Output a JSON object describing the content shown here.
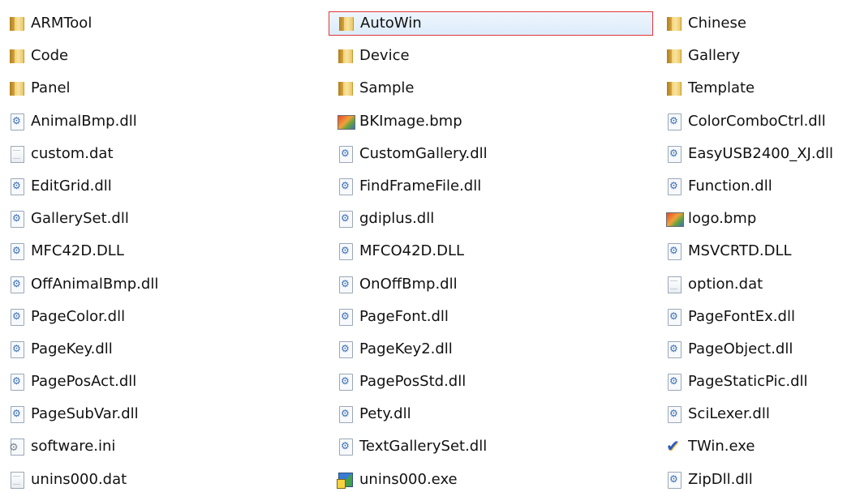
{
  "files": [
    {
      "name": "ARMTool",
      "icon": "folder-icon",
      "selected": false
    },
    {
      "name": "Code",
      "icon": "folder-icon",
      "selected": false
    },
    {
      "name": "Panel",
      "icon": "folder-icon",
      "selected": false
    },
    {
      "name": "AnimalBmp.dll",
      "icon": "dll-icon",
      "selected": false
    },
    {
      "name": "custom.dat",
      "icon": "dat-file-icon",
      "selected": false
    },
    {
      "name": "EditGrid.dll",
      "icon": "dll-icon",
      "selected": false
    },
    {
      "name": "GallerySet.dll",
      "icon": "dll-icon",
      "selected": false
    },
    {
      "name": "MFC42D.DLL",
      "icon": "dll-icon",
      "selected": false
    },
    {
      "name": "OffAnimalBmp.dll",
      "icon": "dll-icon",
      "selected": false
    },
    {
      "name": "PageColor.dll",
      "icon": "dll-icon",
      "selected": false
    },
    {
      "name": "PageKey.dll",
      "icon": "dll-icon",
      "selected": false
    },
    {
      "name": "PagePosAct.dll",
      "icon": "dll-icon",
      "selected": false
    },
    {
      "name": "PageSubVar.dll",
      "icon": "dll-icon",
      "selected": false
    },
    {
      "name": "software.ini",
      "icon": "ini-file-icon",
      "selected": false
    },
    {
      "name": "unins000.dat",
      "icon": "dat-file-icon",
      "selected": false
    },
    {
      "name": "AutoWin",
      "icon": "folder-icon",
      "selected": true
    },
    {
      "name": "Device",
      "icon": "folder-icon",
      "selected": false
    },
    {
      "name": "Sample",
      "icon": "folder-icon",
      "selected": false
    },
    {
      "name": "BKImage.bmp",
      "icon": "bitmap-icon",
      "selected": false
    },
    {
      "name": "CustomGallery.dll",
      "icon": "dll-icon",
      "selected": false
    },
    {
      "name": "FindFrameFile.dll",
      "icon": "dll-icon",
      "selected": false
    },
    {
      "name": "gdiplus.dll",
      "icon": "dll-icon",
      "selected": false
    },
    {
      "name": "MFCO42D.DLL",
      "icon": "dll-icon",
      "selected": false
    },
    {
      "name": "OnOffBmp.dll",
      "icon": "dll-icon",
      "selected": false
    },
    {
      "name": "PageFont.dll",
      "icon": "dll-icon",
      "selected": false
    },
    {
      "name": "PageKey2.dll",
      "icon": "dll-icon",
      "selected": false
    },
    {
      "name": "PagePosStd.dll",
      "icon": "dll-icon",
      "selected": false
    },
    {
      "name": "Pety.dll",
      "icon": "dll-icon",
      "selected": false
    },
    {
      "name": "TextGallerySet.dll",
      "icon": "dll-icon",
      "selected": false
    },
    {
      "name": "unins000.exe",
      "icon": "setup-exe-icon",
      "selected": false
    },
    {
      "name": "Chinese",
      "icon": "folder-icon",
      "selected": false
    },
    {
      "name": "Gallery",
      "icon": "folder-icon",
      "selected": false
    },
    {
      "name": "Template",
      "icon": "folder-icon",
      "selected": false
    },
    {
      "name": "ColorComboCtrl.dll",
      "icon": "dll-icon",
      "selected": false
    },
    {
      "name": "EasyUSB2400_XJ.dll",
      "icon": "dll-icon",
      "selected": false
    },
    {
      "name": "Function.dll",
      "icon": "dll-icon",
      "selected": false
    },
    {
      "name": "logo.bmp",
      "icon": "bitmap-icon",
      "selected": false
    },
    {
      "name": "MSVCRTD.DLL",
      "icon": "dll-icon",
      "selected": false
    },
    {
      "name": "option.dat",
      "icon": "dat-file-icon",
      "selected": false
    },
    {
      "name": "PageFontEx.dll",
      "icon": "dll-icon",
      "selected": false
    },
    {
      "name": "PageObject.dll",
      "icon": "dll-icon",
      "selected": false
    },
    {
      "name": "PageStaticPic.dll",
      "icon": "dll-icon",
      "selected": false
    },
    {
      "name": "SciLexer.dll",
      "icon": "dll-icon",
      "selected": false
    },
    {
      "name": "TWin.exe",
      "icon": "app-exe-icon",
      "selected": false
    },
    {
      "name": "ZipDll.dll",
      "icon": "dll-icon",
      "selected": false
    }
  ],
  "colors": {
    "selection_border": "#e03838",
    "selection_fill": "#dcebfb",
    "background": "#ffffff",
    "text": "#111111"
  }
}
